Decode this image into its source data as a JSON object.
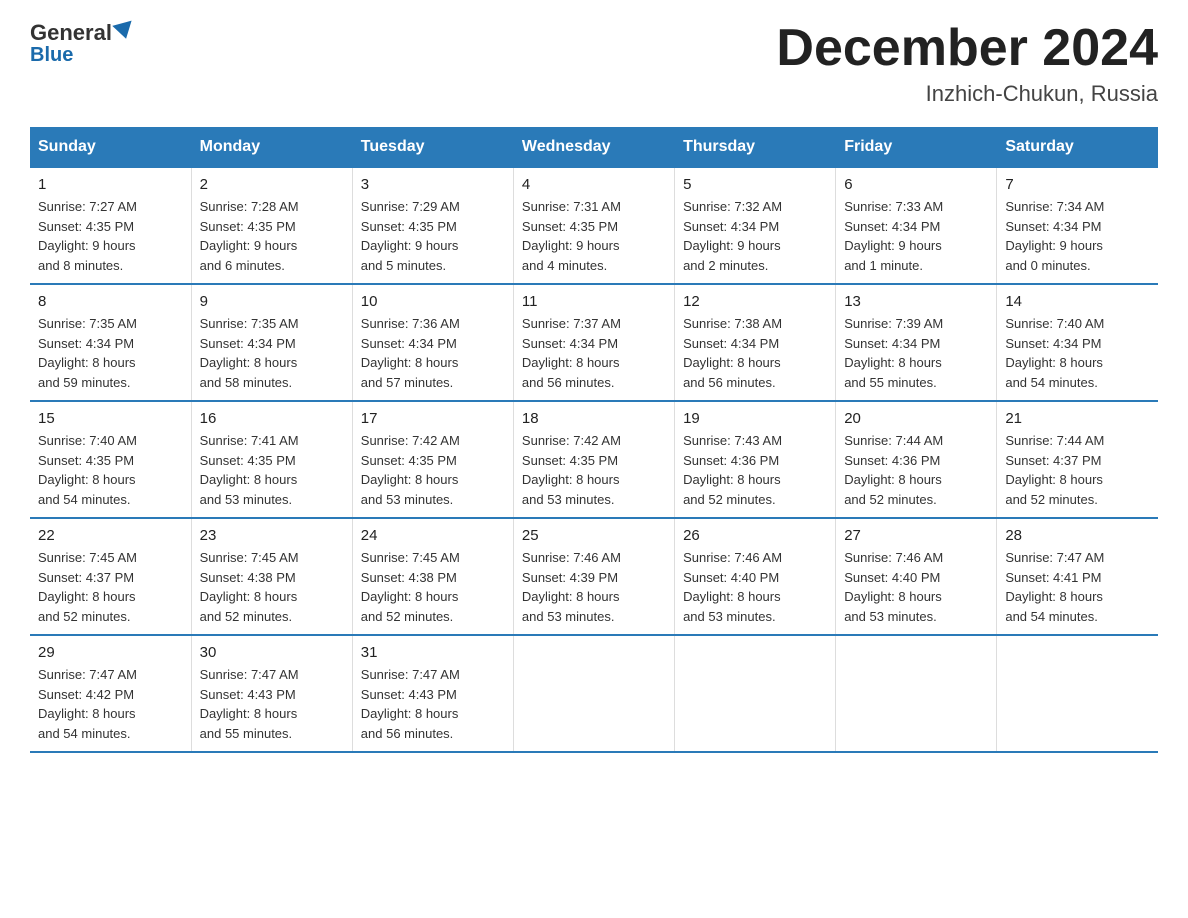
{
  "header": {
    "logo_general": "General",
    "logo_blue": "Blue",
    "month_title": "December 2024",
    "location": "Inzhich-Chukun, Russia"
  },
  "days_of_week": [
    "Sunday",
    "Monday",
    "Tuesday",
    "Wednesday",
    "Thursday",
    "Friday",
    "Saturday"
  ],
  "weeks": [
    [
      {
        "day": "1",
        "sunrise": "7:27 AM",
        "sunset": "4:35 PM",
        "daylight": "9 hours and 8 minutes."
      },
      {
        "day": "2",
        "sunrise": "7:28 AM",
        "sunset": "4:35 PM",
        "daylight": "9 hours and 6 minutes."
      },
      {
        "day": "3",
        "sunrise": "7:29 AM",
        "sunset": "4:35 PM",
        "daylight": "9 hours and 5 minutes."
      },
      {
        "day": "4",
        "sunrise": "7:31 AM",
        "sunset": "4:35 PM",
        "daylight": "9 hours and 4 minutes."
      },
      {
        "day": "5",
        "sunrise": "7:32 AM",
        "sunset": "4:34 PM",
        "daylight": "9 hours and 2 minutes."
      },
      {
        "day": "6",
        "sunrise": "7:33 AM",
        "sunset": "4:34 PM",
        "daylight": "9 hours and 1 minute."
      },
      {
        "day": "7",
        "sunrise": "7:34 AM",
        "sunset": "4:34 PM",
        "daylight": "9 hours and 0 minutes."
      }
    ],
    [
      {
        "day": "8",
        "sunrise": "7:35 AM",
        "sunset": "4:34 PM",
        "daylight": "8 hours and 59 minutes."
      },
      {
        "day": "9",
        "sunrise": "7:35 AM",
        "sunset": "4:34 PM",
        "daylight": "8 hours and 58 minutes."
      },
      {
        "day": "10",
        "sunrise": "7:36 AM",
        "sunset": "4:34 PM",
        "daylight": "8 hours and 57 minutes."
      },
      {
        "day": "11",
        "sunrise": "7:37 AM",
        "sunset": "4:34 PM",
        "daylight": "8 hours and 56 minutes."
      },
      {
        "day": "12",
        "sunrise": "7:38 AM",
        "sunset": "4:34 PM",
        "daylight": "8 hours and 56 minutes."
      },
      {
        "day": "13",
        "sunrise": "7:39 AM",
        "sunset": "4:34 PM",
        "daylight": "8 hours and 55 minutes."
      },
      {
        "day": "14",
        "sunrise": "7:40 AM",
        "sunset": "4:34 PM",
        "daylight": "8 hours and 54 minutes."
      }
    ],
    [
      {
        "day": "15",
        "sunrise": "7:40 AM",
        "sunset": "4:35 PM",
        "daylight": "8 hours and 54 minutes."
      },
      {
        "day": "16",
        "sunrise": "7:41 AM",
        "sunset": "4:35 PM",
        "daylight": "8 hours and 53 minutes."
      },
      {
        "day": "17",
        "sunrise": "7:42 AM",
        "sunset": "4:35 PM",
        "daylight": "8 hours and 53 minutes."
      },
      {
        "day": "18",
        "sunrise": "7:42 AM",
        "sunset": "4:35 PM",
        "daylight": "8 hours and 53 minutes."
      },
      {
        "day": "19",
        "sunrise": "7:43 AM",
        "sunset": "4:36 PM",
        "daylight": "8 hours and 52 minutes."
      },
      {
        "day": "20",
        "sunrise": "7:44 AM",
        "sunset": "4:36 PM",
        "daylight": "8 hours and 52 minutes."
      },
      {
        "day": "21",
        "sunrise": "7:44 AM",
        "sunset": "4:37 PM",
        "daylight": "8 hours and 52 minutes."
      }
    ],
    [
      {
        "day": "22",
        "sunrise": "7:45 AM",
        "sunset": "4:37 PM",
        "daylight": "8 hours and 52 minutes."
      },
      {
        "day": "23",
        "sunrise": "7:45 AM",
        "sunset": "4:38 PM",
        "daylight": "8 hours and 52 minutes."
      },
      {
        "day": "24",
        "sunrise": "7:45 AM",
        "sunset": "4:38 PM",
        "daylight": "8 hours and 52 minutes."
      },
      {
        "day": "25",
        "sunrise": "7:46 AM",
        "sunset": "4:39 PM",
        "daylight": "8 hours and 53 minutes."
      },
      {
        "day": "26",
        "sunrise": "7:46 AM",
        "sunset": "4:40 PM",
        "daylight": "8 hours and 53 minutes."
      },
      {
        "day": "27",
        "sunrise": "7:46 AM",
        "sunset": "4:40 PM",
        "daylight": "8 hours and 53 minutes."
      },
      {
        "day": "28",
        "sunrise": "7:47 AM",
        "sunset": "4:41 PM",
        "daylight": "8 hours and 54 minutes."
      }
    ],
    [
      {
        "day": "29",
        "sunrise": "7:47 AM",
        "sunset": "4:42 PM",
        "daylight": "8 hours and 54 minutes."
      },
      {
        "day": "30",
        "sunrise": "7:47 AM",
        "sunset": "4:43 PM",
        "daylight": "8 hours and 55 minutes."
      },
      {
        "day": "31",
        "sunrise": "7:47 AM",
        "sunset": "4:43 PM",
        "daylight": "8 hours and 56 minutes."
      },
      null,
      null,
      null,
      null
    ]
  ],
  "labels": {
    "sunrise": "Sunrise:",
    "sunset": "Sunset:",
    "daylight": "Daylight:"
  }
}
